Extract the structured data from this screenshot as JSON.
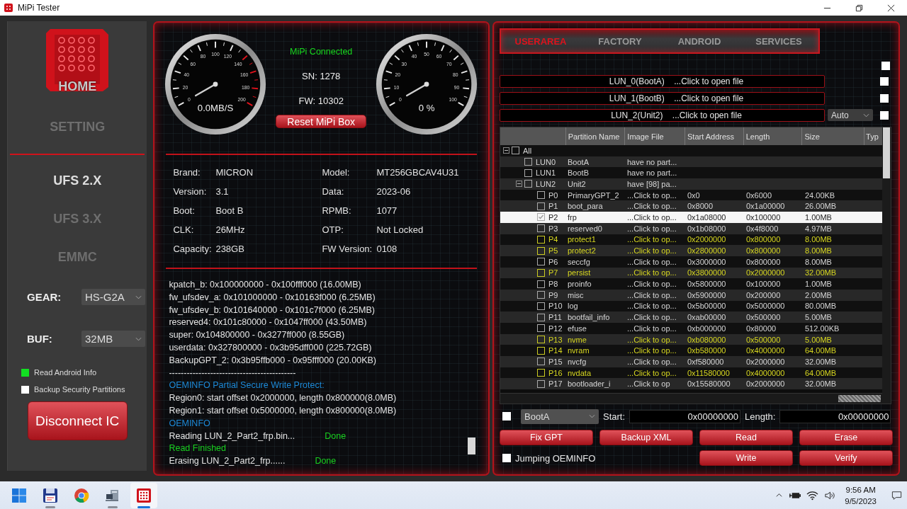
{
  "window": {
    "title": "MiPi Tester"
  },
  "sidebar": {
    "nav": [
      {
        "label": "HOME",
        "selected": false
      },
      {
        "label": "SETTING",
        "selected": false
      }
    ],
    "modes": [
      {
        "label": "UFS 2.X",
        "selected": true
      },
      {
        "label": "UFS 3.X",
        "selected": false
      },
      {
        "label": "EMMC",
        "selected": false
      }
    ],
    "settings": [
      {
        "label": "GEAR:",
        "value": "HS-G2A"
      },
      {
        "label": "BUF:",
        "value": "32MB"
      }
    ],
    "options": [
      {
        "label": "Read Android Info",
        "checked": true
      },
      {
        "label": "Backup Security Partitions",
        "checked": false
      }
    ],
    "button": "Disconnect IC"
  },
  "device": {
    "gauges": [
      {
        "kind": "speed",
        "labels": [
          "0",
          "20",
          "40",
          "60",
          "80",
          "100",
          "120",
          "140",
          "160",
          "180",
          "200"
        ],
        "reading": "0.0MB/S"
      },
      {
        "kind": "percent",
        "labels": [
          "0",
          "10",
          "20",
          "30",
          "40",
          "50",
          "60",
          "70",
          "80",
          "90",
          "100"
        ],
        "reading": "0 %"
      }
    ],
    "status": "MiPi Connected",
    "sn": "SN: 1278",
    "fw": "FW: 10302",
    "reset_button": "Reset MiPi Box",
    "info": [
      {
        "label": "Brand:",
        "value": "MICRON"
      },
      {
        "label": "Model:",
        "value": "MT256GBCAV4U31"
      },
      {
        "label": "Version:",
        "value": "3.1"
      },
      {
        "label": "Data:",
        "value": "2023-06"
      },
      {
        "label": "Boot:",
        "value": "Boot B"
      },
      {
        "label": "RPMB:",
        "value": "1077"
      },
      {
        "label": "CLK:",
        "value": "26MHz"
      },
      {
        "label": "OTP:",
        "value": "Not Locked"
      },
      {
        "label": "Capacity:",
        "value": "238GB"
      },
      {
        "label": "FW Version:",
        "value": "0108"
      }
    ]
  },
  "log": [
    {
      "kind": "plain",
      "text": "kpatch_b: 0x100000000 - 0x100fff000 (16.00MB)"
    },
    {
      "kind": "plain",
      "text": "fw_ufsdev_a: 0x101000000 - 0x10163f000 (6.25MB)"
    },
    {
      "kind": "plain",
      "text": "fw_ufsdev_b: 0x101640000 - 0x101c7f000 (6.25MB)"
    },
    {
      "kind": "plain",
      "text": "reserved4: 0x101c80000 - 0x1047ff000 (43.50MB)"
    },
    {
      "kind": "plain",
      "text": "super: 0x104800000 - 0x3277ff000 (8.55GB)"
    },
    {
      "kind": "plain",
      "text": "userdata: 0x327800000 - 0x3b95dff000 (225.72GB)"
    },
    {
      "kind": "plain",
      "text": "BackupGPT_2: 0x3b95ffb000 - 0x95fff000 (20.00KB)"
    },
    {
      "kind": "plain",
      "text": "-------------------------------------------"
    },
    {
      "kind": "info",
      "text": "OEMINFO Partial Secure Write Protect:"
    },
    {
      "kind": "plain",
      "text": "Region0: start offset 0x2000000, length 0x800000(8.0MB)"
    },
    {
      "kind": "plain",
      "text": "Region1: start offset 0x5000000, length 0x800000(8.0MB)"
    },
    {
      "kind": "info",
      "text": "OEMINFO"
    },
    {
      "kind": "plain",
      "text": "Reading LUN_2_Part2_frp.bin...",
      "status": "Done"
    },
    {
      "kind": "success",
      "text": "Read Finished"
    },
    {
      "kind": "plain",
      "text": "Erasing LUN_2_Part2_frp......",
      "status": "Done"
    }
  ],
  "userarea": {
    "tabs": [
      {
        "label": "USERAREA",
        "selected": true
      },
      {
        "label": "FACTORY",
        "selected": false
      },
      {
        "label": "ANDROID",
        "selected": false
      },
      {
        "label": "SERVICES",
        "selected": false
      }
    ],
    "checkbox_1": {
      "checked": false
    },
    "lun_files": [
      {
        "label": "LUN_0(BootA)",
        "hint": "...Click to open file",
        "checked": false
      },
      {
        "label": "LUN_1(BootB)",
        "hint": "...Click to open file",
        "checked": false
      },
      {
        "label": "LUN_2(Unit2)",
        "hint": "...Click to open file",
        "mode": "Auto",
        "checked": false
      }
    ],
    "table": {
      "columns": [
        "Partition Name",
        "Image File",
        "Start Address",
        "Length",
        "Size",
        "Typ"
      ],
      "tree": {
        "label": "All",
        "checked": false,
        "expanded": true,
        "selected": false,
        "children": [
          {
            "label": "LUN0",
            "name": "BootA",
            "image": "have no part...",
            "checked": false,
            "selected": false
          },
          {
            "label": "LUN1",
            "name": "BootB",
            "image": "have no part...",
            "checked": false,
            "selected": false
          },
          {
            "label": "LUN2",
            "name": "Unit2",
            "image": "have [98] pa...",
            "checked": false,
            "selected": false,
            "expanded": true,
            "children": [
              {
                "label": "P0",
                "name": "PrimaryGPT_2",
                "image": "...Click to op...",
                "start": "0x0",
                "length": "0x6000",
                "size": "24.00KB",
                "highlighted": false,
                "checked": false,
                "selected": false
              },
              {
                "label": "P1",
                "name": "boot_para",
                "image": "...Click to op...",
                "start": "0x8000",
                "length": "0x1a00000",
                "size": "26.00MB",
                "highlighted": false,
                "checked": false,
                "selected": false
              },
              {
                "label": "P2",
                "name": "frp",
                "image": "...Click to op...",
                "start": "0x1a08000",
                "length": "0x100000",
                "size": "1.00MB",
                "highlighted": false,
                "checked": true,
                "selected": true
              },
              {
                "label": "P3",
                "name": "reserved0",
                "image": "...Click to op...",
                "start": "0x1b08000",
                "length": "0x4f8000",
                "size": "4.97MB",
                "highlighted": false,
                "checked": false,
                "selected": false
              },
              {
                "label": "P4",
                "name": "protect1",
                "image": "...Click to op...",
                "start": "0x2000000",
                "length": "0x800000",
                "size": "8.00MB",
                "highlighted": true,
                "checked": false,
                "selected": false
              },
              {
                "label": "P5",
                "name": "protect2",
                "image": "...Click to op...",
                "start": "0x2800000",
                "length": "0x800000",
                "size": "8.00MB",
                "highlighted": true,
                "checked": false,
                "selected": false
              },
              {
                "label": "P6",
                "name": "seccfg",
                "image": "...Click to op...",
                "start": "0x3000000",
                "length": "0x800000",
                "size": "8.00MB",
                "highlighted": false,
                "checked": false,
                "selected": false
              },
              {
                "label": "P7",
                "name": "persist",
                "image": "...Click to op...",
                "start": "0x3800000",
                "length": "0x2000000",
                "size": "32.00MB",
                "highlighted": true,
                "checked": false,
                "selected": false
              },
              {
                "label": "P8",
                "name": "proinfo",
                "image": "...Click to op...",
                "start": "0x5800000",
                "length": "0x100000",
                "size": "1.00MB",
                "highlighted": false,
                "checked": false,
                "selected": false
              },
              {
                "label": "P9",
                "name": "misc",
                "image": "...Click to op...",
                "start": "0x5900000",
                "length": "0x200000",
                "size": "2.00MB",
                "highlighted": false,
                "checked": false,
                "selected": false
              },
              {
                "label": "P10",
                "name": "log",
                "image": "...Click to op...",
                "start": "0x5b00000",
                "length": "0x5000000",
                "size": "80.00MB",
                "highlighted": false,
                "checked": false,
                "selected": false
              },
              {
                "label": "P11",
                "name": "bootfail_info",
                "image": "...Click to op...",
                "start": "0xab00000",
                "length": "0x500000",
                "size": "5.00MB",
                "highlighted": false,
                "checked": false,
                "selected": false
              },
              {
                "label": "P12",
                "name": "efuse",
                "image": "...Click to op...",
                "start": "0xb000000",
                "length": "0x80000",
                "size": "512.00KB",
                "highlighted": false,
                "checked": false,
                "selected": false
              },
              {
                "label": "P13",
                "name": "nvme",
                "image": "...Click to op...",
                "start": "0xb080000",
                "length": "0x500000",
                "size": "5.00MB",
                "highlighted": true,
                "checked": false,
                "selected": false
              },
              {
                "label": "P14",
                "name": "nvram",
                "image": "...Click to op...",
                "start": "0xb580000",
                "length": "0x4000000",
                "size": "64.00MB",
                "highlighted": true,
                "checked": false,
                "selected": false
              },
              {
                "label": "P15",
                "name": "nvcfg",
                "image": "...Click to op...",
                "start": "0xf580000",
                "length": "0x2000000",
                "size": "32.00MB",
                "highlighted": false,
                "checked": false,
                "selected": false
              },
              {
                "label": "P16",
                "name": "nvdata",
                "image": "...Click to op...",
                "start": "0x11580000",
                "length": "0x4000000",
                "size": "64.00MB",
                "highlighted": true,
                "checked": false,
                "selected": false
              },
              {
                "label": "P17",
                "name": "bootloader_i",
                "image": "...Click to op",
                "start": "0x15580000",
                "length": "0x2000000",
                "size": "32.00MB",
                "highlighted": false,
                "checked": false,
                "selected": false
              }
            ]
          }
        ]
      }
    },
    "range": {
      "checked": false,
      "lun": "BootA",
      "start_label": "Start:",
      "start": "0x00000000",
      "length_label": "Length:",
      "length": "0x00000000"
    },
    "buttons": [
      "Fix GPT",
      "Backup XML",
      "Read",
      "Erase"
    ],
    "jumping": {
      "label": "Jumping OEMINFO",
      "checked": false
    },
    "buttons_2": [
      "Write",
      "Verify"
    ]
  },
  "taskbar": {
    "apps": [
      {
        "kind": "start",
        "running": false,
        "selected": false
      },
      {
        "kind": "files",
        "running": true,
        "selected": false
      },
      {
        "kind": "browser",
        "running": false,
        "selected": false
      },
      {
        "kind": "computer",
        "running": true,
        "selected": false
      },
      {
        "kind": "app",
        "running": true,
        "selected": true
      }
    ],
    "time": "9:56 AM",
    "date": "9/5/2023"
  }
}
